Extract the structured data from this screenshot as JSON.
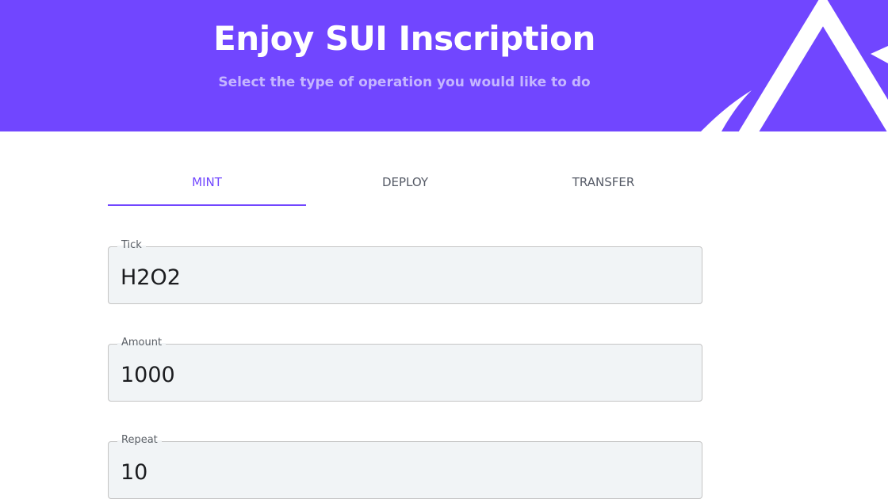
{
  "header": {
    "title": "Enjoy SUI Inscription",
    "subtitle": "Select the type of operation you would like to do"
  },
  "tabs": [
    {
      "label": "MINT",
      "active": true
    },
    {
      "label": "DEPLOY",
      "active": false
    },
    {
      "label": "TRANSFER",
      "active": false
    }
  ],
  "form": {
    "tick": {
      "label": "Tick",
      "value": "H2O2"
    },
    "amount": {
      "label": "Amount",
      "value": "1000"
    },
    "repeat": {
      "label": "Repeat",
      "value": "10"
    }
  },
  "colors": {
    "primary": "#7146ff",
    "subtitle": "#c5b6ff",
    "field_bg": "#f1f4f6",
    "field_border": "#c4c4c4",
    "tab_text": "#555a66"
  },
  "icons": {
    "logo": "triangle-logo-icon"
  }
}
